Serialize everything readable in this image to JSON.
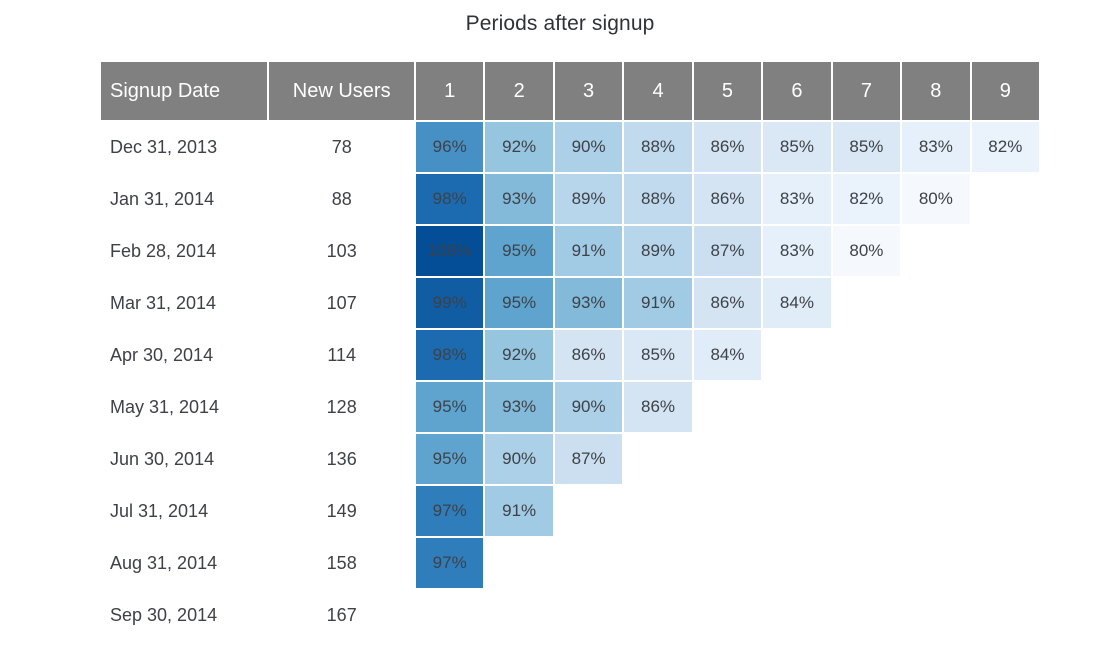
{
  "title": "Periods after signup",
  "table": {
    "headers": {
      "date": "Signup Date",
      "new_users": "New Users",
      "periods": [
        "1",
        "2",
        "3",
        "4",
        "5",
        "6",
        "7",
        "8",
        "9"
      ]
    }
  },
  "colors": {
    "header_background": "#808080",
    "header_text": "#ffffff",
    "body_text": "#3d4248",
    "scale_min": "#f5f9fd",
    "scale_max": "#034e96",
    "page_background": "#ffffff"
  },
  "chart_data": {
    "type": "heatmap",
    "title": "Periods after signup",
    "xlabel": "Periods after signup",
    "ylabel": "Signup Date",
    "x_categories": [
      "1",
      "2",
      "3",
      "4",
      "5",
      "6",
      "7",
      "8",
      "9"
    ],
    "y_categories": [
      "Dec 31, 2013",
      "Jan 31, 2014",
      "Feb 28, 2014",
      "Mar 31, 2014",
      "Apr 30, 2014",
      "May 31, 2014",
      "Jun 30, 2014",
      "Jul 31, 2014",
      "Aug 31, 2014",
      "Sep 30, 2014"
    ],
    "value_unit": "%",
    "value_range": [
      80,
      100
    ],
    "new_users": [
      78,
      88,
      103,
      107,
      114,
      128,
      136,
      149,
      158,
      167
    ],
    "rows": [
      {
        "signup_date": "Dec 31, 2013",
        "new_users": "78",
        "values": [
          "96%",
          "92%",
          "90%",
          "88%",
          "86%",
          "85%",
          "85%",
          "83%",
          "82%"
        ],
        "numeric": [
          96,
          92,
          90,
          88,
          86,
          85,
          85,
          83,
          82
        ]
      },
      {
        "signup_date": "Jan 31, 2014",
        "new_users": "88",
        "values": [
          "98%",
          "93%",
          "89%",
          "88%",
          "86%",
          "83%",
          "82%",
          "80%"
        ],
        "numeric": [
          98,
          93,
          89,
          88,
          86,
          83,
          82,
          80
        ]
      },
      {
        "signup_date": "Feb 28, 2014",
        "new_users": "103",
        "values": [
          "100%",
          "95%",
          "91%",
          "89%",
          "87%",
          "83%",
          "80%"
        ],
        "numeric": [
          100,
          95,
          91,
          89,
          87,
          83,
          80
        ]
      },
      {
        "signup_date": "Mar 31, 2014",
        "new_users": "107",
        "values": [
          "99%",
          "95%",
          "93%",
          "91%",
          "86%",
          "84%"
        ],
        "numeric": [
          99,
          95,
          93,
          91,
          86,
          84
        ]
      },
      {
        "signup_date": "Apr 30, 2014",
        "new_users": "114",
        "values": [
          "98%",
          "92%",
          "86%",
          "85%",
          "84%"
        ],
        "numeric": [
          98,
          92,
          86,
          85,
          84
        ]
      },
      {
        "signup_date": "May 31, 2014",
        "new_users": "128",
        "values": [
          "95%",
          "93%",
          "90%",
          "86%"
        ],
        "numeric": [
          95,
          93,
          90,
          86
        ]
      },
      {
        "signup_date": "Jun 30, 2014",
        "new_users": "136",
        "values": [
          "95%",
          "90%",
          "87%"
        ],
        "numeric": [
          95,
          90,
          87
        ]
      },
      {
        "signup_date": "Jul 31, 2014",
        "new_users": "149",
        "values": [
          "97%",
          "91%"
        ],
        "numeric": [
          97,
          91
        ]
      },
      {
        "signup_date": "Aug 31, 2014",
        "new_users": "158",
        "values": [
          "97%"
        ],
        "numeric": [
          97
        ]
      },
      {
        "signup_date": "Sep 30, 2014",
        "new_users": "167",
        "values": [],
        "numeric": []
      }
    ]
  }
}
